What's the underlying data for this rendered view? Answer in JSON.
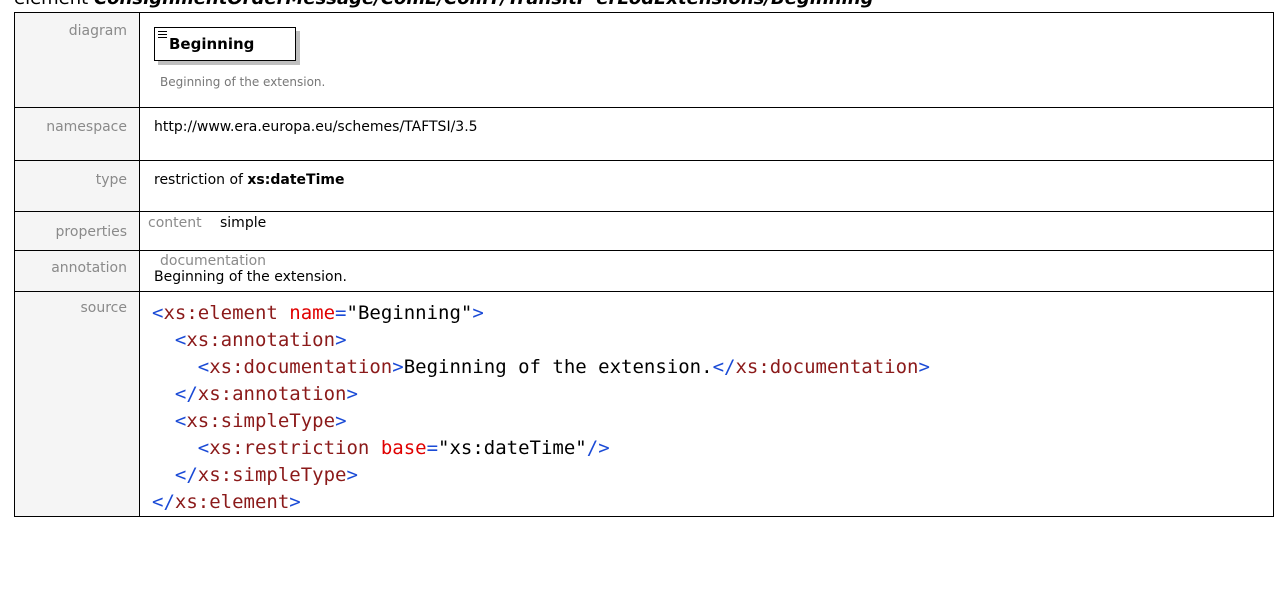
{
  "header": {
    "kind": "element",
    "path": "ConsignmentOrderMessage/ComE/ComT/TransitP erLodExtensions/Beginning"
  },
  "rows": {
    "diagram": {
      "label": "diagram",
      "element_name": "Beginning",
      "element_doc": "Beginning of the extension.",
      "icon": "documentation-lines-icon"
    },
    "namespace": {
      "label": "namespace",
      "value": "http://www.era.europa.eu/schemes/TAFTSI/3.5"
    },
    "type": {
      "label": "type",
      "prefix": "restriction of ",
      "base": "xs:dateTime"
    },
    "properties": {
      "label": "properties",
      "key": "content",
      "value": "simple"
    },
    "annotation": {
      "label": "annotation",
      "key": "documentation",
      "text": "Beginning of the extension."
    },
    "source": {
      "label": "source",
      "lines": [
        {
          "indent": "",
          "open": "<",
          "tag": "xs:element",
          "attr": " name",
          "eq": "=",
          "str": "\"Beginning\"",
          "close": ">",
          "text": "",
          "open2": "",
          "tag2": "",
          "close2": ""
        },
        {
          "indent": "  ",
          "open": "<",
          "tag": "xs:annotation",
          "attr": "",
          "eq": "",
          "str": "",
          "close": ">",
          "text": "",
          "open2": "",
          "tag2": "",
          "close2": ""
        },
        {
          "indent": "    ",
          "open": "<",
          "tag": "xs:documentation",
          "attr": "",
          "eq": "",
          "str": "",
          "close": ">",
          "text": "Beginning of the extension.",
          "open2": "</",
          "tag2": "xs:documentation",
          "close2": ">"
        },
        {
          "indent": "  ",
          "open": "</",
          "tag": "xs:annotation",
          "attr": "",
          "eq": "",
          "str": "",
          "close": ">",
          "text": "",
          "open2": "",
          "tag2": "",
          "close2": ""
        },
        {
          "indent": "  ",
          "open": "<",
          "tag": "xs:simpleType",
          "attr": "",
          "eq": "",
          "str": "",
          "close": ">",
          "text": "",
          "open2": "",
          "tag2": "",
          "close2": ""
        },
        {
          "indent": "    ",
          "open": "<",
          "tag": "xs:restriction",
          "attr": " base",
          "eq": "=",
          "str": "\"xs:dateTime\"",
          "close": "/>",
          "text": "",
          "open2": "",
          "tag2": "",
          "close2": ""
        },
        {
          "indent": "  ",
          "open": "</",
          "tag": "xs:simpleType",
          "attr": "",
          "eq": "",
          "str": "",
          "close": ">",
          "text": "",
          "open2": "",
          "tag2": "",
          "close2": ""
        },
        {
          "indent": "",
          "open": "</",
          "tag": "xs:element",
          "attr": "",
          "eq": "",
          "str": "",
          "close": ">",
          "text": "",
          "open2": "",
          "tag2": "",
          "close2": ""
        }
      ]
    }
  },
  "colors": {
    "tag": "#8b1a1a",
    "attribute": "#e00000",
    "punctuation": "#1a4ad6",
    "label_text": "#8a8a8a"
  }
}
